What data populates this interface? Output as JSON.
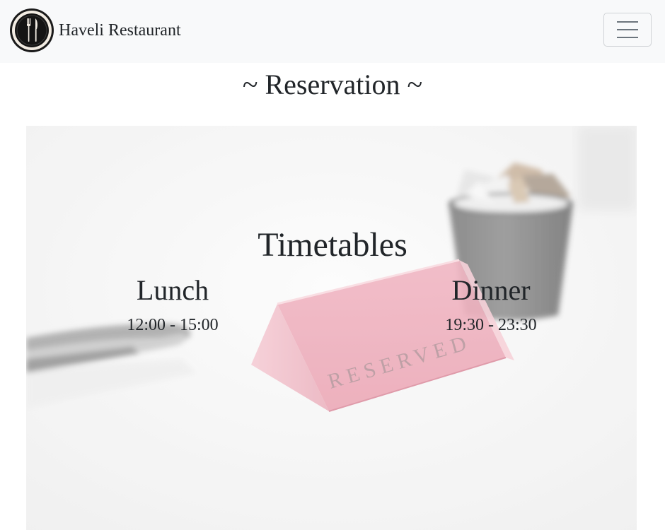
{
  "nav": {
    "brand_name": "Haveli Restaurant",
    "logo_icon": "fork-knife-plate-icon",
    "menu_icon": "hamburger-menu-icon"
  },
  "page": {
    "title": "~ Reservation ~"
  },
  "hero": {
    "image_subject": "reserved-table-sign-photo",
    "sign_text": "RESERVED",
    "heading": "Timetables",
    "slots": [
      {
        "name": "Lunch",
        "hours": "12:00 - 15:00"
      },
      {
        "name": "Dinner",
        "hours": "19:30 - 23:30"
      }
    ]
  },
  "colors": {
    "navbar_bg": "#f8f9fa",
    "text": "#212529",
    "sign_pink": "#e8a0ae"
  }
}
